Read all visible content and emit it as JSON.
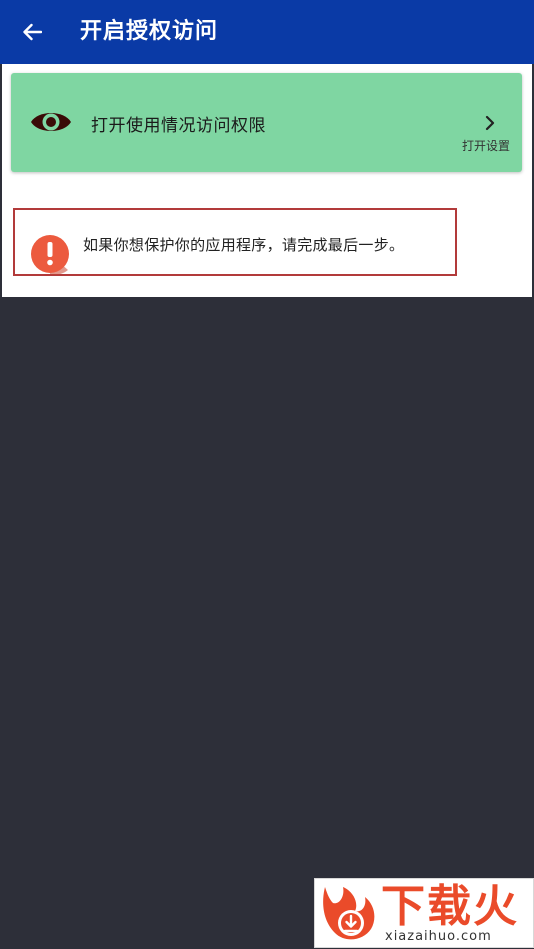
{
  "app_bar": {
    "title": "开启授权访问",
    "back_icon": "arrow-back-icon",
    "background": "#0a3aa6"
  },
  "permission_card": {
    "icon": "eye-icon",
    "label": "打开使用情况访问权限",
    "action_label": "打开设置",
    "chevron_icon": "chevron-right-icon",
    "background": "#7fd6a2"
  },
  "warning": {
    "icon": "alert-exclamation-icon",
    "text": "如果你想保护你的应用程序，请完成最后一步。",
    "border_color": "#b23a3a",
    "icon_color": "#ec5a3e"
  },
  "watermark": {
    "title": "下载火",
    "url": "xiazaihuo.com",
    "logo_icon": "fire-download-logo",
    "accent": "#ea4b2a"
  }
}
